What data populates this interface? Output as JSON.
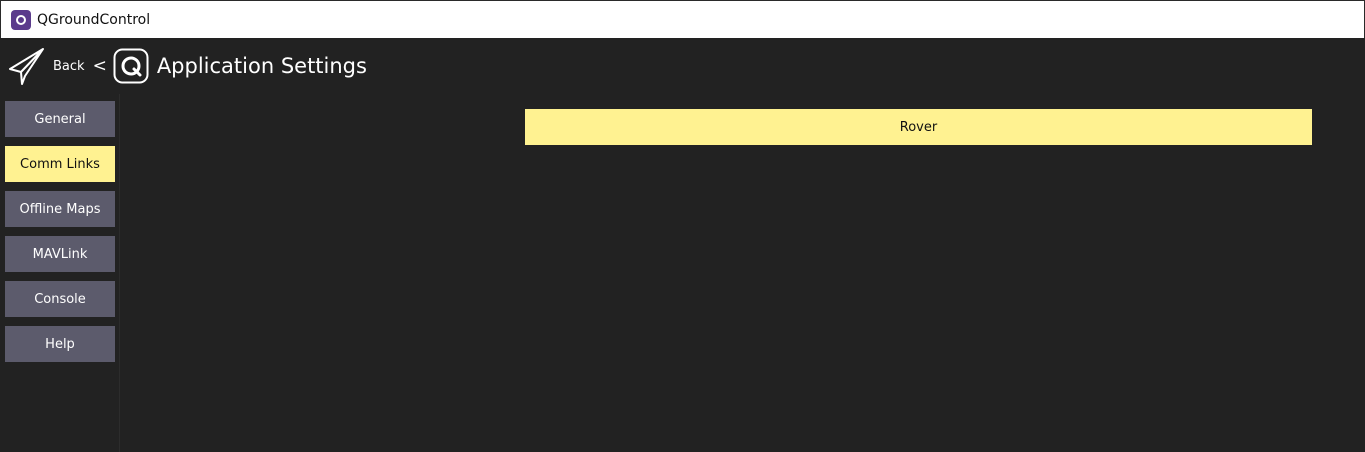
{
  "window": {
    "title": "QGroundControl",
    "app_icon": "qgc-app-icon"
  },
  "header": {
    "back_icon": "paper-plane-icon",
    "back_label": "Back",
    "separator": "<",
    "settings_icon": "qgc-logo-icon",
    "title": "Application Settings"
  },
  "sidebar": {
    "items": [
      {
        "label": "General",
        "active": false
      },
      {
        "label": "Comm Links",
        "active": true
      },
      {
        "label": "Offline Maps",
        "active": false
      },
      {
        "label": "MAVLink",
        "active": false
      },
      {
        "label": "Console",
        "active": false
      },
      {
        "label": "Help",
        "active": false
      }
    ]
  },
  "main": {
    "vehicle_label": "Rover"
  },
  "colors": {
    "background": "#222222",
    "accent": "#fff291",
    "button": "#5c5b6c",
    "text": "#ffffff"
  }
}
